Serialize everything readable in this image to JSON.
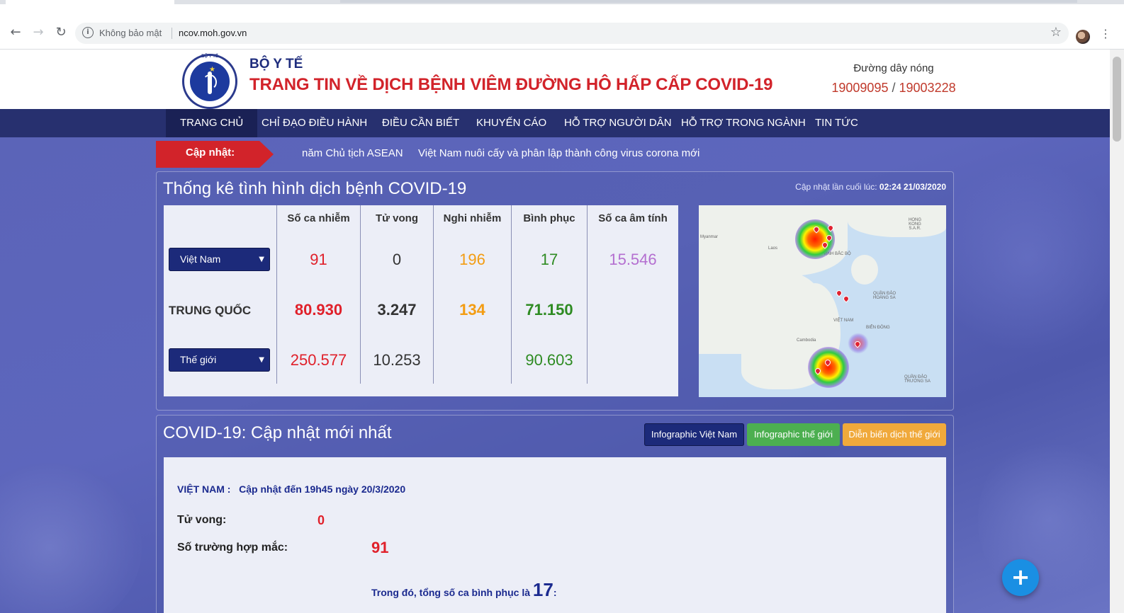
{
  "browser": {
    "insecure_label": "Không bảo mật",
    "url": "ncov.moh.gov.vn",
    "back_icon": "←",
    "forward_icon": "→",
    "reload_icon": "↻",
    "info_icon": "i",
    "star_icon": "☆",
    "menu_icon": "⋮"
  },
  "header": {
    "org": "BỘ Y TẾ",
    "title": "TRANG TIN VỀ DỊCH BỆNH VIÊM ĐƯỜNG HÔ HẤP CẤP COVID-19",
    "logo_text": "BỘ Y TẾ",
    "hotline_label": "Đường dây nóng",
    "hotline_1": "19009095",
    "hotline_sep": "/",
    "hotline_2": "19003228"
  },
  "nav": {
    "items": [
      {
        "label": "Trang chủ"
      },
      {
        "label": "Chỉ đạo điều hành"
      },
      {
        "label": "Điều cần biết"
      },
      {
        "label": "Khuyến cáo"
      },
      {
        "label": "Hỗ trợ người dân"
      },
      {
        "label": "Hỗ trợ trong ngành"
      },
      {
        "label": "Tin tức"
      }
    ]
  },
  "ticker": {
    "label": "Cập nhật:",
    "items": [
      "năm Chủ tịch ASEAN",
      "Việt Nam nuôi cấy và phân lập thành công virus corona mới"
    ]
  },
  "stats": {
    "title": "Thống kê tình hình dịch bệnh COVID-19",
    "last_update_label": "Cập nhật lần cuối lúc:",
    "last_update_value": "02:24 21/03/2020",
    "headers": [
      "Số ca nhiễm",
      "Tử vong",
      "Nghi nhiễm",
      "Bình phục",
      "Số ca âm tính"
    ],
    "vietnam": {
      "select": "Việt Nam",
      "infected": "91",
      "deaths": "0",
      "suspected": "196",
      "recovered": "17",
      "negative": "15.546"
    },
    "china": {
      "label": "TRUNG QUỐC",
      "infected": "80.930",
      "deaths": "3.247",
      "suspected": "134",
      "recovered": "71.150"
    },
    "world": {
      "select": "Thế giới",
      "infected": "250.577",
      "deaths": "10.253",
      "recovered": "90.603"
    },
    "caret": "▼"
  },
  "map": {
    "labels": [
      "Myanmar",
      "Laos",
      "HONG KONG S.A.R.",
      "VỊNH BẮC BỘ",
      "QUẦN ĐẢO HOÀNG SA",
      "VIỆT NAM",
      "BIỂN ĐÔNG",
      "Cambodia",
      "QUẦN ĐẢO TRƯỜNG SA"
    ]
  },
  "updates": {
    "title": "COVID-19: Cập nhật mới nhất",
    "buttons": [
      {
        "label": "Infographic Việt Nam",
        "color": "#1c2a7a"
      },
      {
        "label": "Infographic thế giới",
        "color": "#4caf50"
      },
      {
        "label": "Diễn biến dịch thế giới",
        "color": "#f0a93b"
      }
    ],
    "vn_label": "VIỆT NAM :",
    "vn_updated": "Cập nhật đến 19h45 ngày 20/3/2020",
    "deaths_label": "Tử vong:",
    "deaths_value": "0",
    "cases_label": "Số trường hợp mắc:",
    "cases_value": "91",
    "recover_prefix": "Trong đó, tổng số ca bình phục là",
    "recover_value": "17",
    "recover_suffix": ":"
  },
  "fab_icon": "+",
  "colors": {
    "nav": "#27306f",
    "accent_red": "#d2232a"
  }
}
